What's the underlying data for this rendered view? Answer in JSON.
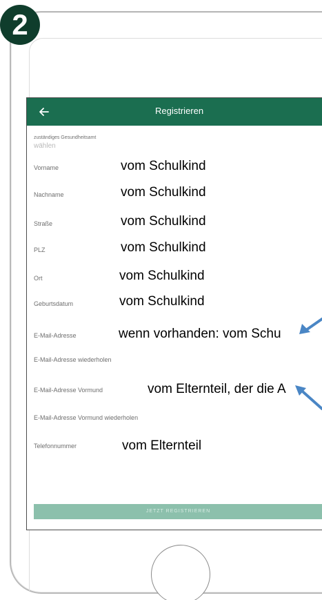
{
  "step": {
    "number": "2"
  },
  "header": {
    "title": "Registrieren",
    "back_icon": "back-arrow-icon"
  },
  "colors": {
    "header_bg": "#1b6e50",
    "badge_bg": "#0f3d2c",
    "button_bg": "#8cc0ac",
    "arrow": "#4a86c5"
  },
  "form": {
    "health_office": {
      "label": "zuständiges Gesundheitsamt",
      "placeholder": "wählen"
    },
    "fields": [
      {
        "label": "Vorname",
        "note": "vom Schulkind"
      },
      {
        "label": "Nachname",
        "note": "vom Schulkind"
      },
      {
        "label": "Straße",
        "note": "vom Schulkind"
      },
      {
        "label": "PLZ",
        "note": "vom Schulkind"
      },
      {
        "label": "Ort",
        "note": "vom Schulkind"
      },
      {
        "label": "Geburtsdatum",
        "note": "vom Schulkind"
      },
      {
        "label": "E-Mail-Adresse",
        "note": "wenn vorhanden: vom Schu"
      },
      {
        "label": "E-Mail-Adresse wiederholen",
        "note": ""
      },
      {
        "label": "E-Mail-Adresse Vormund",
        "note": "vom Elternteil, der die A"
      },
      {
        "label": "E-Mail-Adresse Vormund wiederholen",
        "note": ""
      },
      {
        "label": "Telefonnummer",
        "note": "vom Elternteil"
      }
    ],
    "submit_label": "JETZT REGISTRIEREN"
  }
}
